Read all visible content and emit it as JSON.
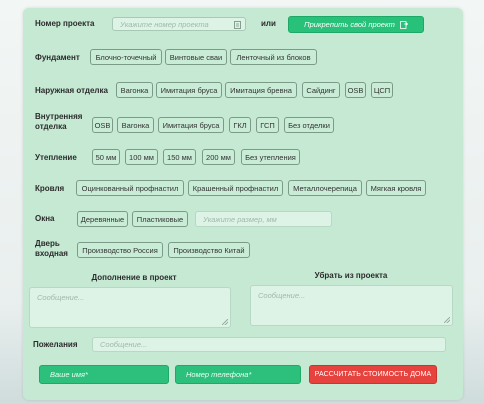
{
  "project": {
    "label": "Номер проекта",
    "placeholder": "Укажите номер проекта",
    "or": "или",
    "attach_button": "Прикрепить свой проект"
  },
  "foundation": {
    "label": "Фундамент",
    "options": [
      "Блочно-точечный",
      "Винтовые сваи",
      "Ленточный из блоков"
    ]
  },
  "exterior": {
    "label": "Наружная отделка",
    "options": [
      "Вагонка",
      "Имитация бруса",
      "Имитация бревна",
      "Сайдинг",
      "OSB",
      "ЦСП"
    ]
  },
  "interior": {
    "label_line1": "Внутренняя",
    "label_line2": "отделка",
    "options": [
      "OSB",
      "Вагонка",
      "Имитация бруса",
      "ГКЛ",
      "ГСП",
      "Без отделки"
    ]
  },
  "insulation": {
    "label": "Утепление",
    "options": [
      "50 мм",
      "100 мм",
      "150 мм",
      "200 мм",
      "Без утепления"
    ]
  },
  "roof": {
    "label": "Кровля",
    "options": [
      "Оцинкованный профнастил",
      "Крашенный профнастил",
      "Металлочерепица",
      "Мягкая кровля"
    ]
  },
  "windows": {
    "label": "Окна",
    "options": [
      "Деревянные",
      "Пластиковые"
    ],
    "size_placeholder": "Укажите размер, мм"
  },
  "door": {
    "label_line1": "Дверь",
    "label_line2": "входная",
    "options": [
      "Производство Россия",
      "Производство Китай"
    ]
  },
  "add_to_project": {
    "label": "Дополнение в проект",
    "placeholder": "Сообщение..."
  },
  "remove_from_project": {
    "label": "Убрать из проекта",
    "placeholder": "Сообщение..."
  },
  "wishes": {
    "label": "Пожелания",
    "placeholder": "Сообщение..."
  },
  "footer": {
    "name_placeholder": "Ваше имя*",
    "phone_placeholder": "Номер телефона*",
    "submit": "РАССЧИТАТЬ СТОИМОСТЬ ДОМА"
  },
  "colors": {
    "panel": "#c5e9d3",
    "accent_green": "#28c17a",
    "accent_red": "#e6433f"
  },
  "icons": {
    "project_input": "document-icon",
    "attach": "attach-file-icon"
  }
}
